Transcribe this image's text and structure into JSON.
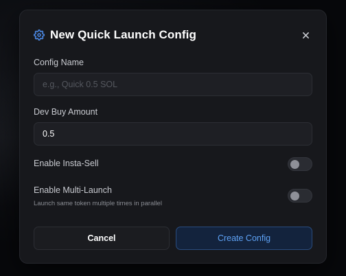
{
  "dialog": {
    "title": "New Quick Launch Config",
    "icons": {
      "header": "gear-icon",
      "close": "close-icon"
    }
  },
  "form": {
    "config_name": {
      "label": "Config Name",
      "placeholder": "e.g., Quick 0.5 SOL",
      "value": ""
    },
    "dev_buy": {
      "label": "Dev Buy Amount",
      "value": "0.5"
    },
    "insta_sell": {
      "label": "Enable Insta-Sell",
      "enabled": false
    },
    "multi_launch": {
      "label": "Enable Multi-Launch",
      "hint": "Launch same token multiple times in parallel",
      "enabled": false
    }
  },
  "actions": {
    "cancel_label": "Cancel",
    "create_label": "Create Config"
  },
  "colors": {
    "accent": "#5ea2f5",
    "modal_bg": "#17181c"
  }
}
